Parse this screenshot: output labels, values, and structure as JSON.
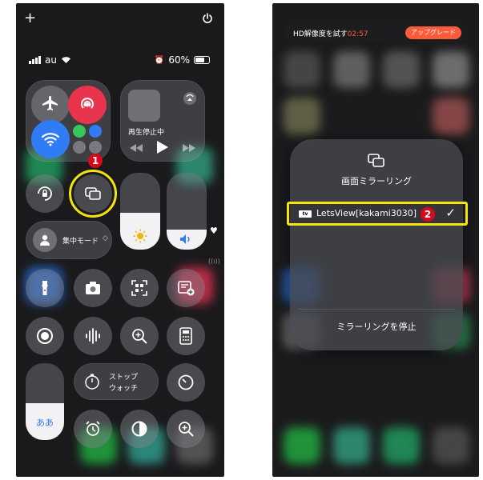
{
  "left_phone": {
    "top_plus": "+",
    "status": {
      "carrier": "au",
      "battery": "60%"
    },
    "media": {
      "label": "再生停止中"
    },
    "focus": {
      "label": "集中モード"
    },
    "stopwatch": {
      "line1": "ストップ",
      "line2": "ウォッチ"
    },
    "text_size_label": "ああ",
    "annotation": "1"
  },
  "right_phone": {
    "hd_text": "HD解像度を試す",
    "hd_time": "02:57",
    "upgrade_label": "アップグレード",
    "panel_title": "画面ミラーリング",
    "device_name": "LetsView[kakami3030]",
    "device_check": "✓",
    "tv_badge": "tv",
    "stop_label": "ミラーリングを停止",
    "annotation": "2"
  },
  "colors": {
    "highlight": "#f4e40c",
    "badge": "#d8081a",
    "airplane": "#f08a24",
    "airdrop": "#e8344c",
    "wifi": "#2f7cf6",
    "cellular": "#36c759",
    "bluetooth": "#2f7cf6",
    "upgrade": "#ff5a3a"
  }
}
